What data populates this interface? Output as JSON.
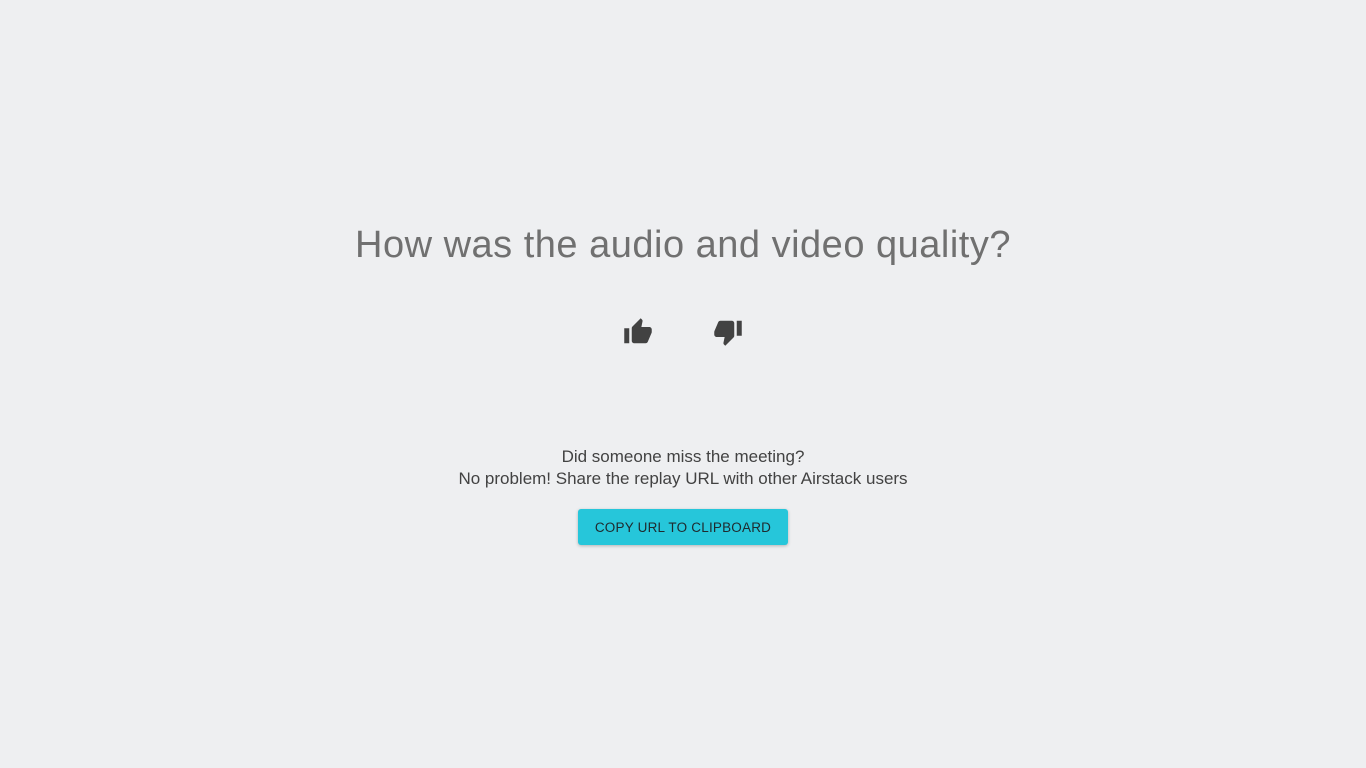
{
  "survey": {
    "question": "How was the audio and video quality?",
    "thumbs_up_icon": "thumbs-up-icon",
    "thumbs_down_icon": "thumbs-down-icon"
  },
  "share": {
    "line1": "Did someone miss the meeting?",
    "line2": "No problem! Share the replay URL with other Airstack users",
    "copy_button_label": "COPY URL TO CLIPBOARD"
  },
  "colors": {
    "background": "#eeeff1",
    "accent": "#26c6da",
    "icon": "#424242",
    "question_text": "#707070"
  }
}
